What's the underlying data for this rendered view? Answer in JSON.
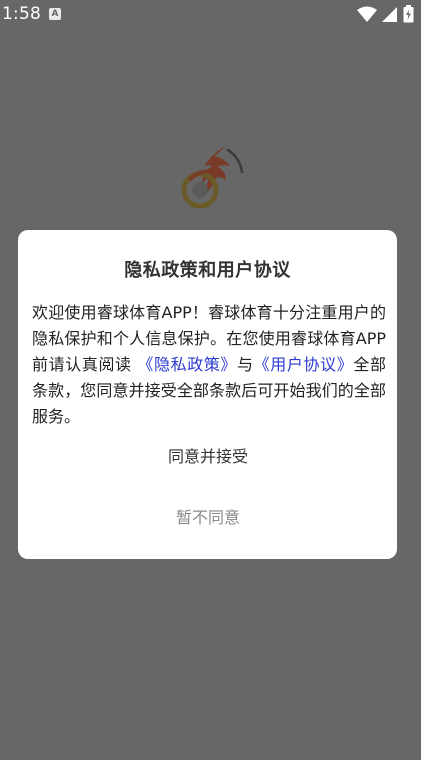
{
  "status_bar": {
    "time": "1:58",
    "notification_icon_letter": "A",
    "icons": [
      "a-notification-icon",
      "wifi-icon",
      "signal-icon",
      "battery-icon"
    ]
  },
  "background": {
    "logo_icon": "comet-ball-logo-icon"
  },
  "dialog": {
    "title": "隐私政策和用户协议",
    "body_intro": "欢迎使用睿球体育APP！睿球体育十分注重用户的隐私保护和个人信息保护。在您使用睿球体育APP前请认真阅读",
    "privacy_link": "《隐私政策》",
    "conjunction": "与",
    "terms_link": "《用户协议》",
    "body_outro": "全部条款，您同意并接受全部条款后可开始我们的全部服务。",
    "agree_label": "同意并接受",
    "disagree_label": "暂不同意",
    "colors": {
      "link": "#2d3bd0",
      "overlay": "#676767",
      "disagree_text": "#8a8a8a"
    }
  }
}
